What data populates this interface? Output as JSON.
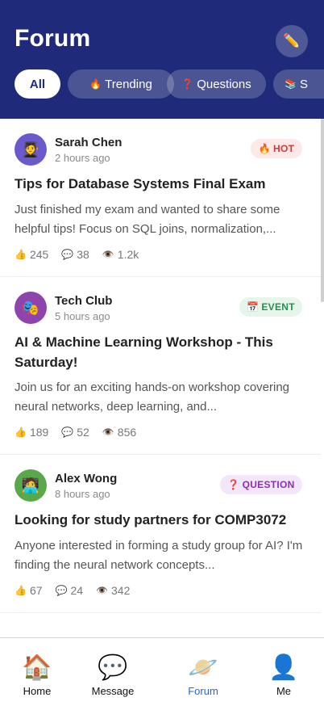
{
  "header": {
    "title": "Forum",
    "compose_icon": "pencil-icon"
  },
  "tabs": [
    {
      "label": "All",
      "icon": ""
    },
    {
      "label": "Trending",
      "icon": "🔥"
    },
    {
      "label": "Questions",
      "icon": "❓"
    },
    {
      "label": "S",
      "icon": "📚"
    }
  ],
  "posts": [
    {
      "avatar": "🧑‍🎓",
      "avatar_color": "#6a5acd",
      "author": "Sarah Chen",
      "time": "2 hours ago",
      "badge": {
        "icon": "🔥",
        "label": "HOT",
        "bg": "#fde8e8",
        "color": "#d03a3a"
      },
      "title": "Tips for Database Systems Final Exam",
      "excerpt": "Just finished my exam and wanted to share some helpful tips! Focus on SQL joins, normalization,...",
      "likes": "245",
      "comments": "38",
      "views": "1.2k"
    },
    {
      "avatar": "🎭",
      "avatar_color": "#8e44ad",
      "author": "Tech Club",
      "time": "5 hours ago",
      "badge": {
        "icon": "📅",
        "label": "EVENT",
        "bg": "#e6f6ea",
        "color": "#2e8b57"
      },
      "title": "AI & Machine Learning Workshop - This Saturday!",
      "excerpt": "Join us for an exciting hands-on workshop covering neural networks, deep learning, and...",
      "likes": "189",
      "comments": "52",
      "views": "856"
    },
    {
      "avatar": "🧑‍💻",
      "avatar_color": "#5aa84a",
      "author": "Alex Wong",
      "time": "8 hours ago",
      "badge": {
        "icon": "❓",
        "label": "QUESTION",
        "bg": "#f3e6fa",
        "color": "#8b2fb0"
      },
      "title": "Looking for study partners for COMP3072",
      "excerpt": "Anyone interested in forming a study group for AI? I'm finding the neural network concepts...",
      "likes": "67",
      "comments": "24",
      "views": "342"
    }
  ],
  "stat_icons": {
    "likes": "👍",
    "comments": "💬",
    "views": "👁️"
  },
  "nav": [
    {
      "label": "Home",
      "icon": "🏠"
    },
    {
      "label": "Message",
      "icon": "💬"
    },
    {
      "label": "Forum",
      "icon": "🪐"
    },
    {
      "label": "Me",
      "icon": "👤"
    }
  ],
  "colors": {
    "header": "#1f2b7a",
    "active_nav": "#2a66d6"
  }
}
